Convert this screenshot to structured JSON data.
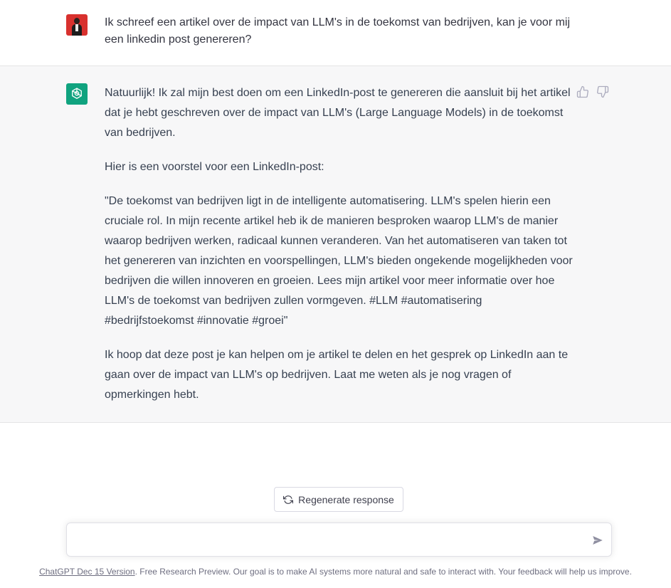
{
  "conversation": {
    "user_message": "Ik schreef een artikel over de impact van LLM's in de toekomst van bedrijven, kan je voor mij een linkedin post genereren?",
    "assistant_paragraphs": [
      "Natuurlijk! Ik zal mijn best doen om een LinkedIn-post te genereren die aansluit bij het artikel dat je hebt geschreven over de impact van LLM's (Large Language Models) in de toekomst van bedrijven.",
      "Hier is een voorstel voor een LinkedIn-post:",
      "\"De toekomst van bedrijven ligt in de intelligente automatisering. LLM's spelen hierin een cruciale rol. In mijn recente artikel heb ik de manieren besproken waarop LLM's de manier waarop bedrijven werken, radicaal kunnen veranderen. Van het automatiseren van taken tot het genereren van inzichten en voorspellingen, LLM's bieden ongekende mogelijkheden voor bedrijven die willen innoveren en groeien. Lees mijn artikel voor meer informatie over hoe LLM's de toekomst van bedrijven zullen vormgeven. #LLM #automatisering #bedrijfstoekomst #innovatie #groei\"",
      "Ik hoop dat deze post je kan helpen om je artikel te delen en het gesprek op LinkedIn aan te gaan over de impact van LLM's op bedrijven. Laat me weten als je nog vragen of opmerkingen hebt."
    ]
  },
  "actions": {
    "regenerate_label": "Regenerate response"
  },
  "composer": {
    "value": "",
    "placeholder": ""
  },
  "footer": {
    "version_link": "ChatGPT Dec 15 Version",
    "text": ". Free Research Preview. Our goal is to make AI systems more natural and safe to interact with. Your feedback will help us improve."
  },
  "icons": {
    "thumbs_up": "thumbs-up-icon",
    "thumbs_down": "thumbs-down-icon",
    "regenerate": "refresh-icon",
    "send": "send-icon",
    "assistant_logo": "openai-logo-icon"
  },
  "colors": {
    "assistant_bg": "#f7f7f8",
    "bot_avatar": "#10a37f",
    "user_avatar": "#d8312e",
    "text": "#343541"
  }
}
